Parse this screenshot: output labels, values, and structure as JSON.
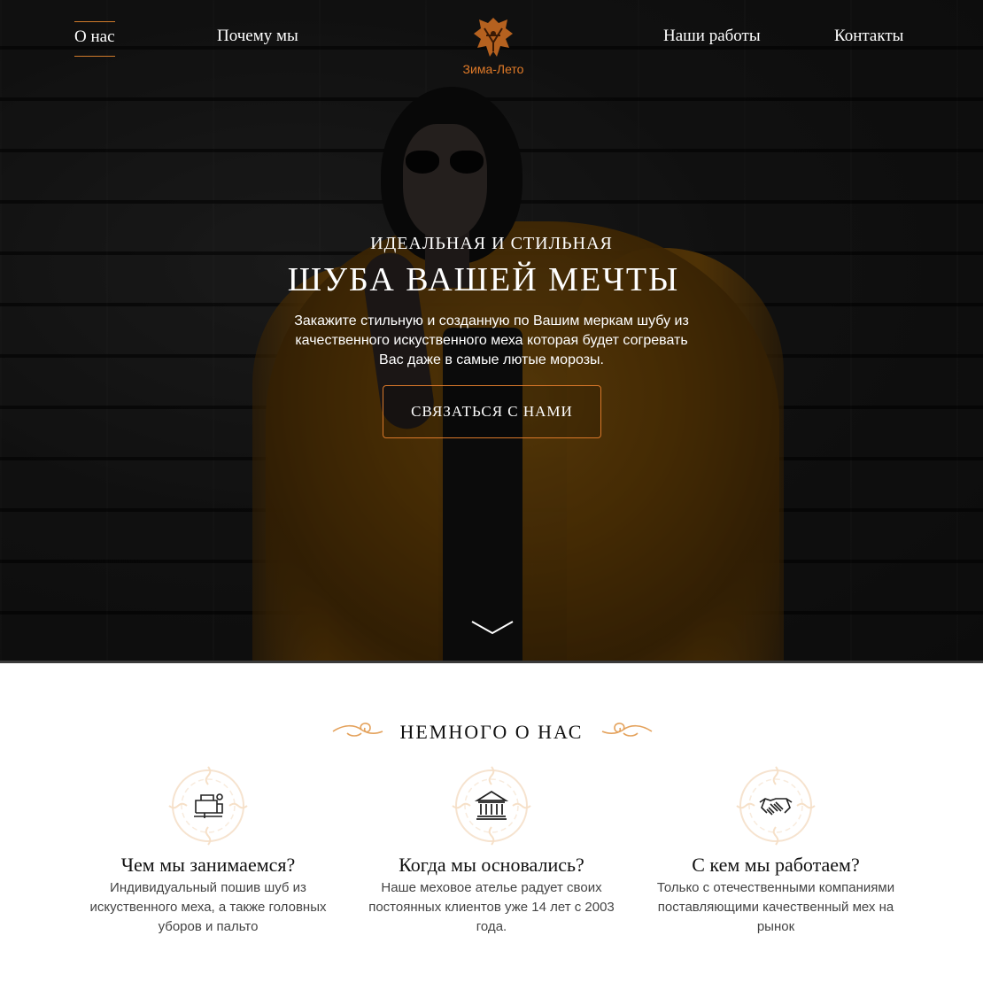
{
  "nav": {
    "items": [
      {
        "label": "О нас",
        "active": true
      },
      {
        "label": "Почему мы",
        "active": false
      },
      {
        "label": "Наши работы",
        "active": false
      },
      {
        "label": "Контакты",
        "active": false
      }
    ],
    "logo_text": "Зима-Лето"
  },
  "hero": {
    "subtitle": "ИДЕАЛЬНАЯ И СТИЛЬНАЯ",
    "title": "ШУБА ВАШЕЙ МЕЧТЫ",
    "text": "Закажите стильную и созданную по Вашим меркам шубу из качественного искуственного меха которая будет согревать Вас даже в самые лютые морозы.",
    "button": "СВЯЗАТЬСЯ С НАМИ",
    "scroll_icon": "chevron-down-icon"
  },
  "about": {
    "title": "НЕМНОГО О НАС",
    "items": [
      {
        "icon": "sewing-machine-icon",
        "heading": "Чем мы занимаемся?",
        "text": "Индивидуальный пошив шуб из искуственного меха, а также головных уборов и пальто"
      },
      {
        "icon": "building-columns-icon",
        "heading": "Когда мы основались?",
        "text": "Наше меховое ателье радует своих постоянных клиентов уже 14 лет с 2003 года."
      },
      {
        "icon": "handshake-icon",
        "heading": "С кем мы работаем?",
        "text": "Только с отечественными компаниями поставляющими качественный мех на рынок"
      }
    ]
  },
  "colors": {
    "accent": "#e07a28",
    "hero_bg": "#1b1b1b",
    "text_dark": "#111111"
  }
}
